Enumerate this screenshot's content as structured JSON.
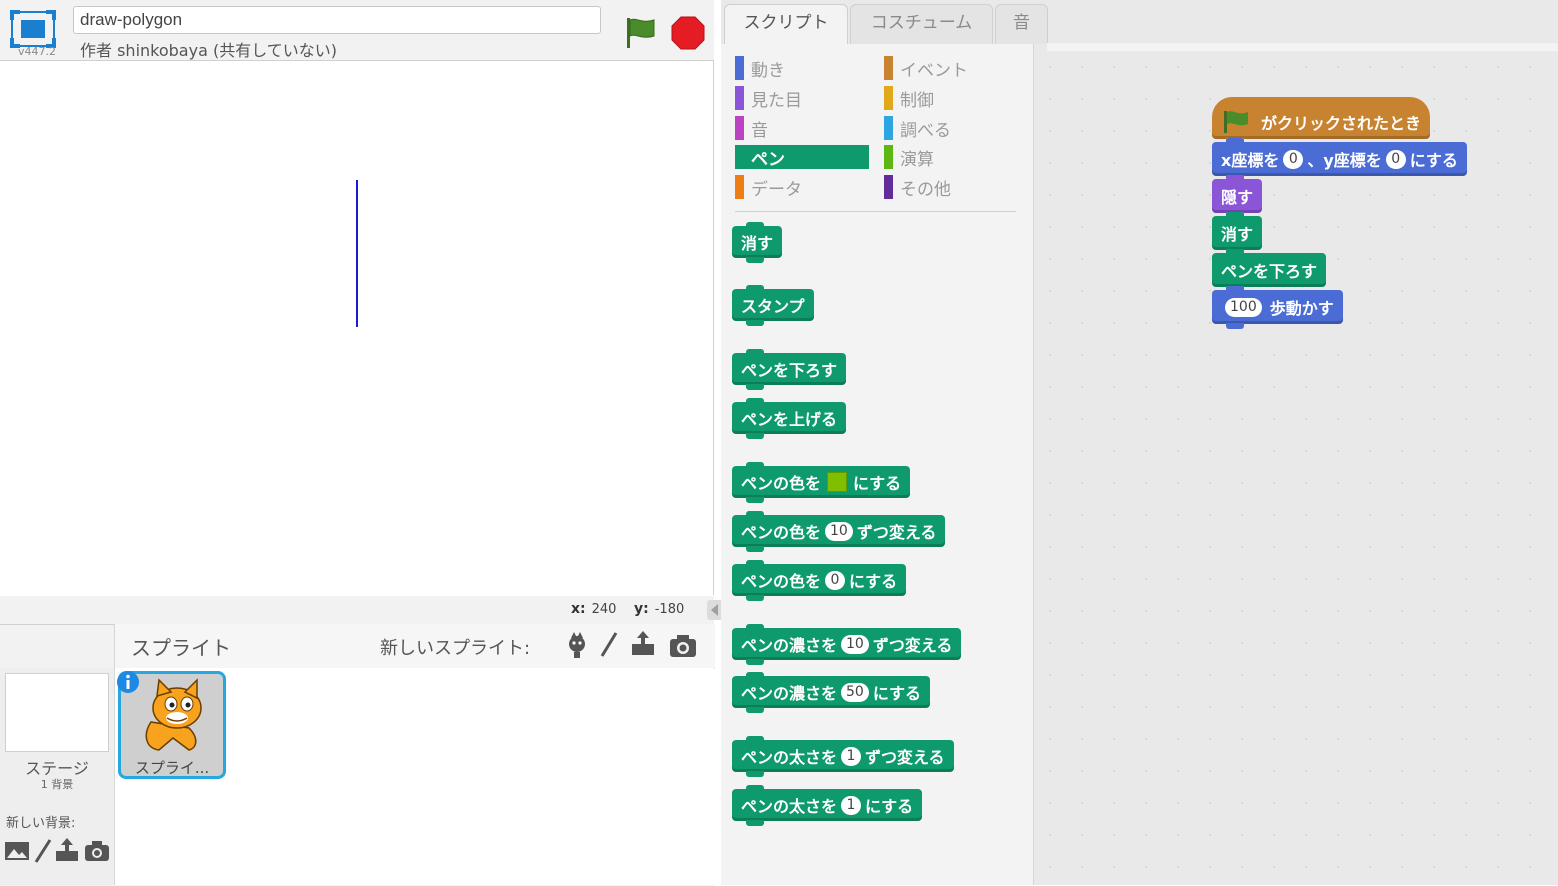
{
  "app": {
    "version": "v447.2",
    "project_title": "draw-polygon",
    "author_line": "作者 shinkobaya (共有していない)"
  },
  "stage": {
    "pen_line_color": "#1a1ad6",
    "coords": {
      "x_label": "x:",
      "x_value": "240",
      "y_label": "y:",
      "y_value": "-180"
    }
  },
  "sprites": {
    "title": "スプライト",
    "new_sprite_label": "新しいスプライト:",
    "stage_label": "ステージ",
    "backdrop_count": "1 背景",
    "new_backdrop_label": "新しい背景:",
    "sprite_name": "スプライ..."
  },
  "tabs": [
    {
      "label": "スクリプト",
      "active": true
    },
    {
      "label": "コスチューム",
      "active": false
    },
    {
      "label": "音",
      "active": false
    }
  ],
  "categories": [
    {
      "label": "動き",
      "color": "#4a6cd4"
    },
    {
      "label": "見た目",
      "color": "#8a55d7"
    },
    {
      "label": "音",
      "color": "#bb42c3"
    },
    {
      "label": "ペン",
      "color": "#0e9a6c",
      "selected": true
    },
    {
      "label": "データ",
      "color": "#ee7d16"
    },
    {
      "label": "イベント",
      "color": "#c88330"
    },
    {
      "label": "制御",
      "color": "#e1a91a"
    },
    {
      "label": "調べる",
      "color": "#2ca5e2"
    },
    {
      "label": "演算",
      "color": "#5cb712"
    },
    {
      "label": "その他",
      "color": "#632d99"
    }
  ],
  "palette_blocks": {
    "clear": "消す",
    "stamp": "スタンプ",
    "pen_down": "ペンを下ろす",
    "pen_up": "ペンを上げる",
    "set_color_pre": "ペンの色を",
    "set_color_post": "にする",
    "change_color_pre": "ペンの色を",
    "change_color_val": "10",
    "change_color_post": "ずつ変える",
    "set_color_num_pre": "ペンの色を",
    "set_color_num_val": "0",
    "set_color_num_post": "にする",
    "change_shade_pre": "ペンの濃さを",
    "change_shade_val": "10",
    "change_shade_post": "ずつ変える",
    "set_shade_pre": "ペンの濃さを",
    "set_shade_val": "50",
    "set_shade_post": "にする",
    "change_size_pre": "ペンの太さを",
    "change_size_val": "1",
    "change_size_post": "ずつ変える",
    "set_size_pre": "ペンの太さを",
    "set_size_val": "1",
    "set_size_post": "にする"
  },
  "script": {
    "hat_label": "がクリックされたとき",
    "goto_a": "x座標を",
    "goto_x": "0",
    "goto_b": "、y座標を",
    "goto_y": "0",
    "goto_c": "にする",
    "hide": "隠す",
    "clear": "消す",
    "pen_down": "ペンを下ろす",
    "move_val": "100",
    "move_label": "歩動かす"
  },
  "colors": {
    "pen": "#0e9a6c",
    "motion": "#4a6cd4",
    "looks": "#8a55d7",
    "events": "#c88330",
    "flag_green": "#4a8c2a",
    "stop_red": "#e61c24",
    "selection_blue": "#25a8e0"
  }
}
